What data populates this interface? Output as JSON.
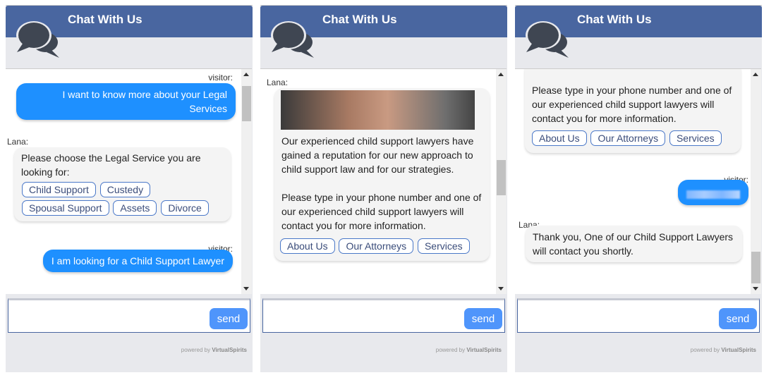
{
  "header_title": "Chat With Us",
  "send_label": "send",
  "powered_by": "powered by",
  "brand": "VirtualSpirits",
  "colors": {
    "header": "#4966a0",
    "visitor_bubble": "#1e90ff",
    "send": "#4f95fb"
  },
  "panels": [
    {
      "messages": [
        {
          "sender": "visitor:",
          "text": "I want  to know more about your Legal Services"
        },
        {
          "sender": "Lana:",
          "text": "Please choose the Legal Service you are looking for:",
          "options": [
            "Child Support",
            "Custedy",
            "Spousal Support",
            "Assets",
            "Divorce"
          ]
        },
        {
          "sender": "visitor:",
          "text": "I am looking for a Child Support Lawyer"
        }
      ]
    },
    {
      "messages": [
        {
          "sender": "Lana:",
          "image": "hands-photo",
          "text1": "Our experienced child support lawyers have gained a reputation for our new approach to child support law and for our strategies.",
          "text2": "Please type in your phone number and one of our experienced child support lawyers will contact you for more information.",
          "options": [
            "About Us",
            "Our Attorneys",
            "Services"
          ]
        }
      ]
    },
    {
      "messages": [
        {
          "text": "Please type in your phone number and one of our experienced child support lawyers will contact you for more information.",
          "options": [
            "About Us",
            "Our Attorneys",
            "Services"
          ]
        },
        {
          "sender": "visitor:",
          "text": "[redacted phone number]"
        },
        {
          "sender": "Lana:",
          "text": "Thank you, One of our Child Support Lawyers will contact you shortly."
        }
      ]
    }
  ]
}
